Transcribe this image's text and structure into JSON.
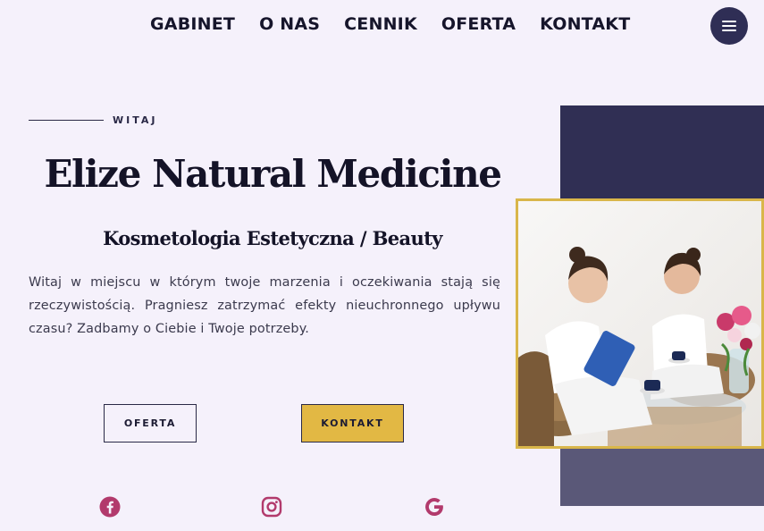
{
  "nav": {
    "items": [
      "GABINET",
      "O NAS",
      "CENNIK",
      "OFERTA",
      "KONTAKT"
    ],
    "menu_icon": "hamburger-menu-icon"
  },
  "hero": {
    "eyebrow": "WITAJ",
    "title": "Elize Natural Medicine",
    "subtitle": "Kosmetologia Estetyczna / Beauty",
    "paragraph": "Witaj w miejscu w którym twoje marzenia i oczekiwania stają się rzeczywistością. Pragniesz zatrzymać efekty nieuchronnego upływu czasu? Zadbamy o Ciebie i Twoje potrzeby.",
    "buttons": {
      "oferta": "OFERTA",
      "kontakt": "KONTAKT"
    }
  },
  "social": {
    "icons": [
      "facebook-icon",
      "instagram-icon",
      "google-icon"
    ],
    "color": "#b23a6c"
  },
  "colors": {
    "background": "#f5f1fb",
    "navy": "#302f54",
    "slate": "#5a5878",
    "gold": "#e2b844"
  }
}
